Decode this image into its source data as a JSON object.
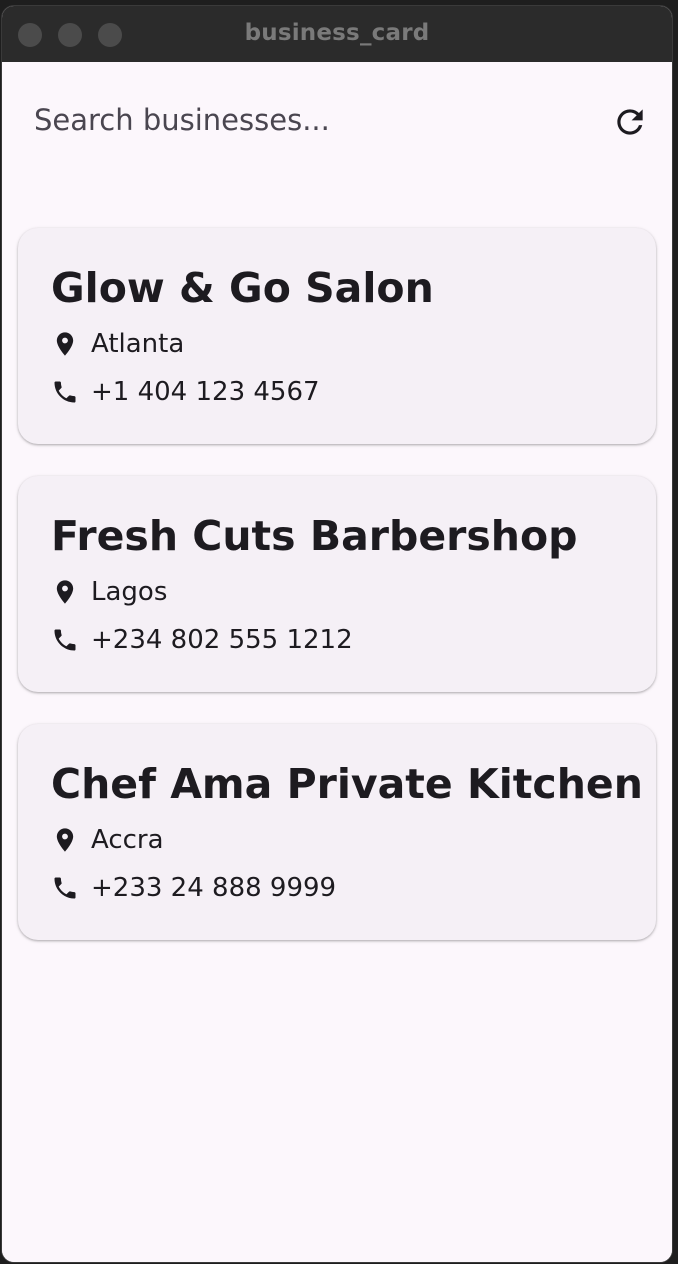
{
  "window": {
    "title": "business_card"
  },
  "search": {
    "placeholder": "Search businesses..."
  },
  "icons": {
    "refresh": "refresh-icon",
    "location": "location-pin-icon",
    "phone": "phone-icon"
  },
  "colors": {
    "background": "#fcf7fc",
    "card": "#f5f0f6",
    "text": "#1d1b20",
    "titlebar": "#2b2b2b"
  },
  "businesses": [
    {
      "name": "Glow & Go Salon",
      "city": "Atlanta",
      "phone": "+1 404 123 4567"
    },
    {
      "name": "Fresh Cuts Barbershop",
      "city": "Lagos",
      "phone": "+234 802 555 1212"
    },
    {
      "name": "Chef Ama Private Kitchen",
      "city": "Accra",
      "phone": "+233 24 888 9999"
    }
  ]
}
